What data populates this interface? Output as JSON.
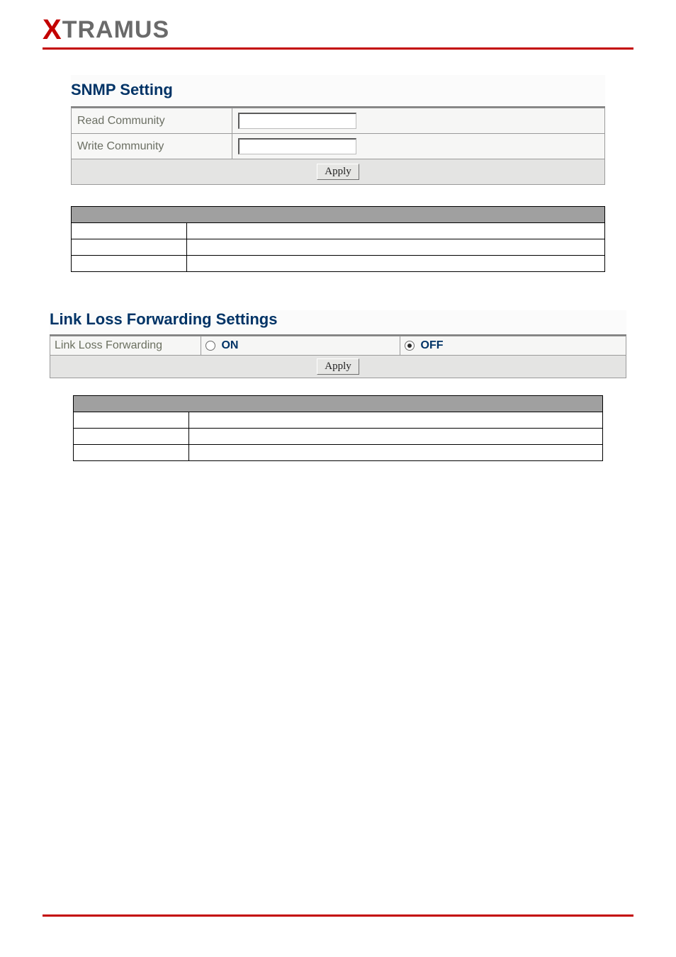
{
  "brand": {
    "x": "X",
    "rest": "TRAMUS"
  },
  "snmp": {
    "title": "SNMP Setting",
    "read_label": "Read Community",
    "write_label": "Write Community",
    "read_value": "",
    "write_value": "",
    "apply_label": "Apply"
  },
  "llf": {
    "title": "Link Loss Forwarding Settings",
    "row_label": "Link Loss Forwarding",
    "on_label": "ON",
    "off_label": "OFF",
    "selected": "off",
    "apply_label": "Apply"
  }
}
